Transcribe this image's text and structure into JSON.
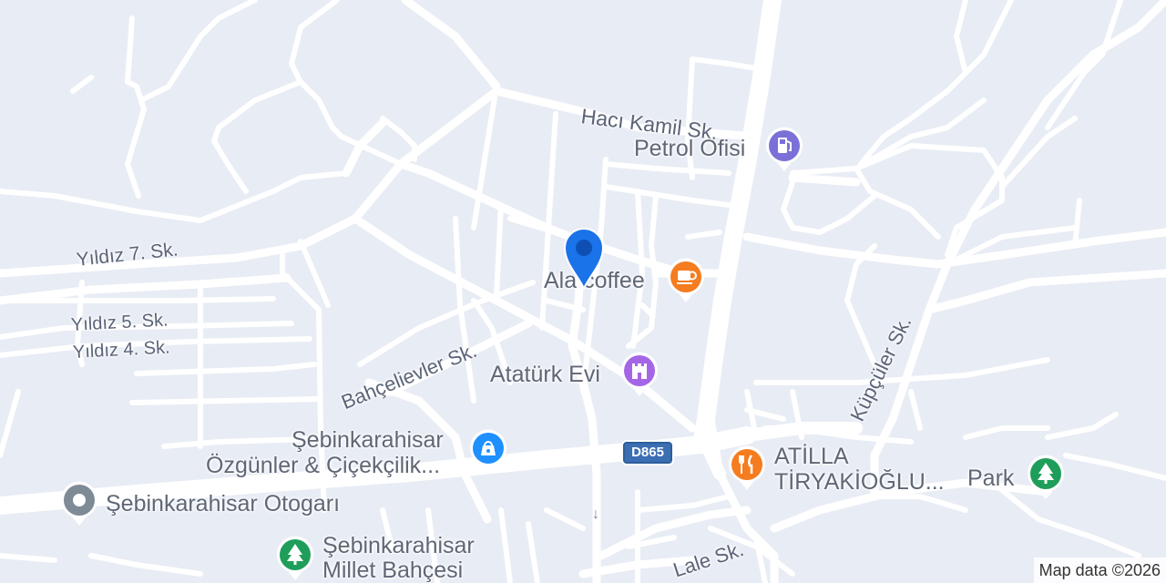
{
  "map": {
    "streets": {
      "haci_kamil": "Hacı Kamil Sk.",
      "yildiz7": "Yıldız 7. Sk.",
      "yildiz5": "Yıldız 5. Sk.",
      "yildiz4": "Yıldız 4. Sk.",
      "bahcelievler": "Bahçelievler Sk.",
      "kupculer": "Küpçüler Sk.",
      "lale": "Lale Sk."
    },
    "route_shield": "D865",
    "pois": {
      "petrol_ofisi": "Petrol Ofisi",
      "ala_coffee": "Ala coffee",
      "ataturk_evi": "Atatürk Evi",
      "ozgunler_line1": "Şebinkarahisar",
      "ozgunler_line2": "Özgünler & Çiçekçilik...",
      "atilla_line1": "ATİLLA",
      "atilla_line2": "TİRYAKİOĞLU...",
      "park": "Park",
      "otogar": "Şebinkarahisar Otogarı",
      "millet_line1": "Şebinkarahisar",
      "millet_line2": "Millet Bahçesi"
    },
    "pin_icons": {
      "petrol_ofisi": "gas-station-icon",
      "ala_coffee": "coffee-cup-icon",
      "ataturk_evi": "castle-landmark-icon",
      "ozgunler": "shopping-bag-icon",
      "atilla": "restaurant-fork-knife-icon",
      "park": "tree-icon",
      "otogar": "generic-place-icon",
      "millet": "tree-icon"
    },
    "colors": {
      "background": "#e8ecf4",
      "road": "#ffffff",
      "fuel": "#7b70d8",
      "food": "#f57c1f",
      "landmark": "#a566e6",
      "shopping": "#1e90ff",
      "park": "#1e9e5a",
      "generic": "#7e8a96",
      "location_pin": "#1a73e8"
    },
    "attribution": "Map data ©2026"
  }
}
